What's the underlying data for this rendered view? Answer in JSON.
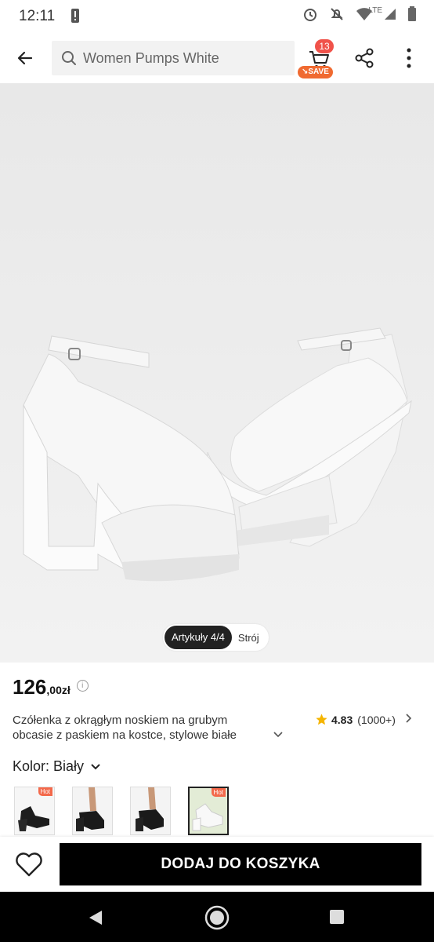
{
  "status_bar": {
    "time": "12:11",
    "network": "LTE"
  },
  "header": {
    "search_query": "Women Pumps White",
    "cart_count": "13",
    "cart_badge": "SAVE"
  },
  "gallery": {
    "counter_label": "Artykuły 4/4",
    "tab_outfit": "Strój"
  },
  "product": {
    "price_main": "126",
    "price_decimal": ",00zł",
    "info_icon": "i",
    "title": "Czółenka z okrągłym noskiem na grubym obcasie z paskiem na kostce, stylowe białe",
    "rating": "4.83",
    "rating_count": "(1000+)",
    "color_label": "Kolor: Biały",
    "thumbnails": [
      {
        "hot": "Hot",
        "color": "black"
      },
      {
        "hot": "",
        "color": "black"
      },
      {
        "hot": "",
        "color": "black"
      },
      {
        "hot": "Hot",
        "color": "white"
      }
    ]
  },
  "bottom_bar": {
    "add_to_cart_label": "DODAJ DO KOSZYKA"
  },
  "colors": {
    "accent": "#f0524a",
    "save_badge": "#f06a31",
    "hot_badge": "#f3694b",
    "star": "#f5b500",
    "button": "#000000"
  }
}
